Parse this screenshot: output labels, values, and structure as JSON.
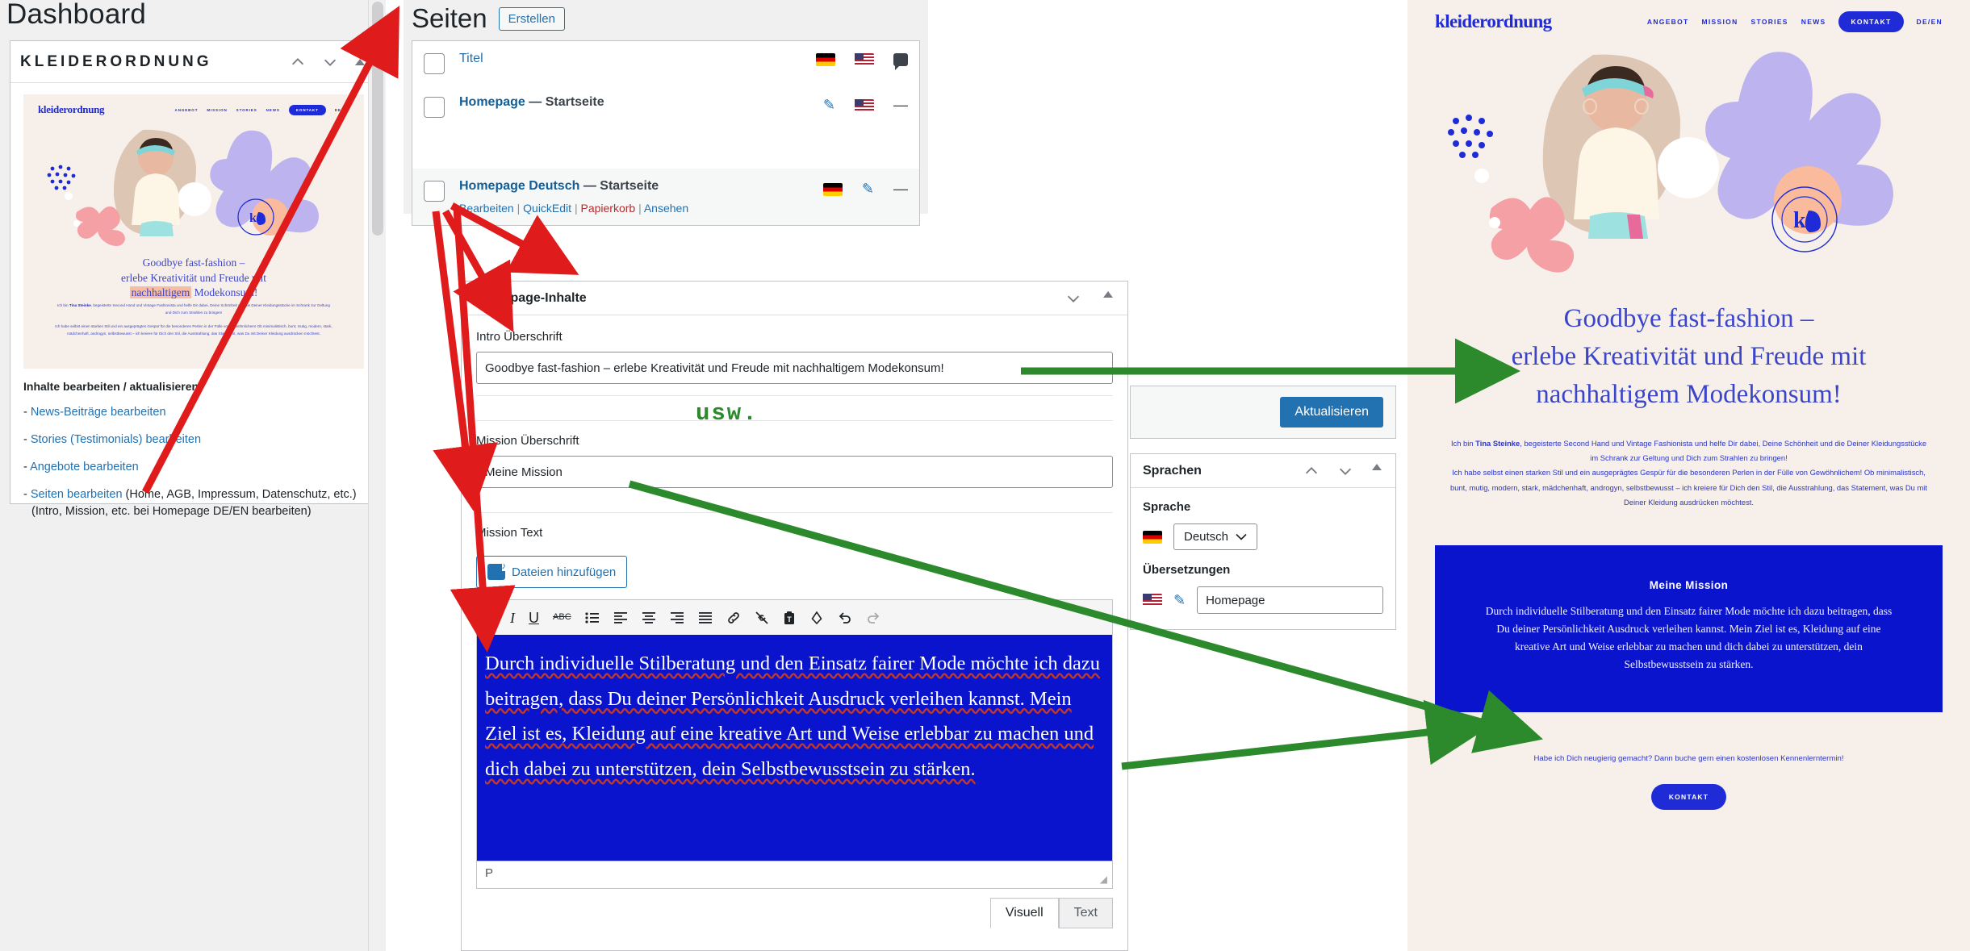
{
  "dashboard": {
    "title": "Dashboard",
    "widget": {
      "title": "KLEIDERORDNUNG",
      "up_icon": "chevron-up-icon",
      "down_icon": "chevron-down-icon",
      "toggle_icon": "caret-up-icon"
    },
    "edit_heading": "Inhalte bearbeiten / aktualisieren",
    "links": [
      {
        "dash": "-",
        "label": "News-Beiträge bearbeiten",
        "note": ""
      },
      {
        "dash": "-",
        "label": "Stories (Testimonials) bearbeiten",
        "note": ""
      },
      {
        "dash": "-",
        "label": "Angebote bearbeiten",
        "note": ""
      },
      {
        "dash": "-",
        "label": "Seiten bearbeiten",
        "note": " (Home, AGB, Impressum, Datenschutz, etc.)",
        "note2": "(Intro, Mission, etc. bei Homepage DE/EN bearbeiten)"
      }
    ]
  },
  "pages": {
    "title": "Seiten",
    "create_label": "Erstellen",
    "header_row": {
      "title": "Titel",
      "flag_de": "flag-de-icon",
      "flag_us": "flag-us-icon",
      "comments": "comment-bubble-icon"
    },
    "rows": [
      {
        "title": "Homepage",
        "separator": "—",
        "suffix": "Startseite",
        "icon_edit": "pencil-icon",
        "icon_flag": "flag-us-icon",
        "icon_dash": "—",
        "actions": []
      },
      {
        "title": "Homepage Deutsch",
        "separator": "—",
        "suffix": "Startseite",
        "icon_flag": "flag-de-icon",
        "icon_edit": "pencil-icon",
        "icon_dash": "—",
        "actions": [
          "Bearbeiten",
          "QuickEdit",
          "Papierkorb",
          "Ansehen"
        ]
      }
    ]
  },
  "metabox": {
    "title": "Homepage-Inhalte",
    "collapse_icon": "chevron-down-icon",
    "toggle_icon": "caret-up-icon",
    "intro_label": "Intro Überschrift",
    "intro_value": "Goodbye fast-fashion – erlebe Kreativität und Freude mit nachhaltigem Modekonsum!",
    "mission_label": "Mission Überschrift",
    "mission_value": "Meine Mission",
    "mission_text_label": "Mission Text",
    "media_button": "Dateien hinzufügen",
    "tabs": [
      {
        "label": "Visuell",
        "active": true
      },
      {
        "label": "Text",
        "active": false
      }
    ],
    "toolbar": [
      {
        "name": "bold-icon",
        "glyph": "B"
      },
      {
        "name": "italic-icon",
        "glyph": "I"
      },
      {
        "name": "underline-icon",
        "glyph": "U"
      },
      {
        "name": "strikethrough-icon",
        "glyph": "ABC"
      },
      {
        "name": "bulleted-list-icon",
        "glyph": "☰"
      },
      {
        "name": "align-left-icon",
        "glyph": "≡"
      },
      {
        "name": "align-center-icon",
        "glyph": "≡"
      },
      {
        "name": "align-right-icon",
        "glyph": "≡"
      },
      {
        "name": "justify-icon",
        "glyph": "≡"
      },
      {
        "name": "insert-link-icon",
        "glyph": "🔗"
      },
      {
        "name": "remove-link-icon",
        "glyph": "⛓"
      },
      {
        "name": "paste-as-text-icon",
        "glyph": "📋"
      },
      {
        "name": "clear-formatting-icon",
        "glyph": "⬨"
      },
      {
        "name": "undo-icon",
        "glyph": "↺"
      },
      {
        "name": "redo-icon",
        "glyph": "↻"
      }
    ],
    "editor_text": "Durch individuelle Stilberatung und den Einsatz fairer Mode möchte ich dazu beitragen, dass Du deiner Persönlichkeit Ausdruck verleihen kannst. Mein Ziel ist es, Kleidung auf eine kreative Art und Weise erlebbar zu machen und dich dabei zu unterstützen, dein Selbstbewusstsein zu stärken.",
    "status_path": "P"
  },
  "sidebar": {
    "update_label": "Aktualisieren",
    "languages_title": "Sprachen",
    "up_icon": "chevron-up-icon",
    "down_icon": "chevron-down-icon",
    "toggle_icon": "caret-up-icon",
    "language_label": "Sprache",
    "language_value": "Deutsch",
    "language_flag": "flag-de-icon",
    "translations_label": "Übersetzungen",
    "translation_flag": "flag-us-icon",
    "translation_edit_icon": "pencil-icon",
    "translation_value": "Homepage"
  },
  "site": {
    "logo": "kleiderordnung",
    "nav": [
      "ANGEBOT",
      "MISSION",
      "STORIES",
      "NEWS"
    ],
    "nav_cta": "KONTAKT",
    "lang_switch": "DE/EN",
    "headline_line1": "Goodbye fast-fashion –",
    "headline_line2": "erlebe Kreativität und Freude mit",
    "headline_line3": "nachhaltigem Modekonsum!",
    "intro_p1_pre": "Ich bin ",
    "intro_p1_name": "Tina Steinke",
    "intro_p1_post": ", begeisterte Second Hand und Vintage Fashionista und helfe Dir dabei, Deine Schönheit und die Deiner Kleidungsstücke im Schrank zur Geltung und Dich zum Strahlen zu bringen!",
    "intro_p2": "Ich habe selbst einen starken Stil und ein ausgeprägtes Gespür für die besonderen Perlen in der Fülle von Gewöhnlichem! Ob minimalistisch, bunt, mutig, modern, stark, mädchenhaft, androgyn, selbstbewusst – ich kreiere für Dich den Stil, die Ausstrahlung, das Statement, was Du mit Deiner Kleidung ausdrücken möchtest.",
    "mission_title": "Meine Mission",
    "mission_text": "Durch individuelle Stilberatung und den Einsatz fairer Mode möchte ich dazu beitragen, dass Du deiner Persönlichkeit Ausdruck verleihen kannst. Mein Ziel ist es, Kleidung auf eine kreative Art und Weise erlebbar zu machen und dich dabei zu unterstützen, dein Selbstbewusstsein zu stärken.",
    "cta_text": "Habe ich Dich neugierig gemacht? Dann buche gern einen kostenlosen Kennenlerntermin!",
    "cta_button": "KONTAKT"
  },
  "annotations": {
    "etc_label": "usw.",
    "arrow_red_color": "#e01b1b",
    "arrow_green_color": "#2c8a2c"
  },
  "colors": {
    "brand_blue": "#1f2bd6",
    "editor_blue": "#0a14cc",
    "wp_blue": "#2271b1",
    "site_bg": "#f7f0ea"
  }
}
